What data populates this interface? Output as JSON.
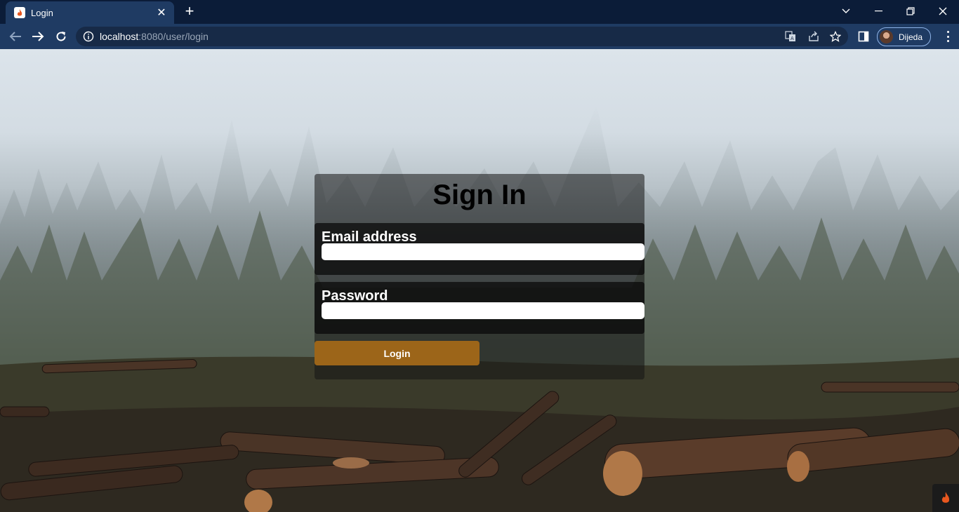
{
  "browser": {
    "tab_title": "Login",
    "url_host": "localhost",
    "url_rest": ":8080/user/login",
    "profile_name": "Dijeda",
    "accent": "#1f3b63",
    "tabstrip_color": "#0b1c38"
  },
  "icons": {
    "favicon": "flame-icon",
    "close": "close-icon",
    "new_tab": "plus-icon",
    "back": "arrow-left-icon",
    "forward": "arrow-right-icon",
    "reload": "reload-icon",
    "site_info": "info-icon",
    "translate": "translate-icon",
    "share": "share-icon",
    "bookmark": "star-icon",
    "side_panel": "side-panel-icon",
    "menu": "kebab-menu-icon",
    "tab_search": "chevron-down-icon",
    "minimize": "minimize-icon",
    "restore": "restore-icon",
    "window_close": "close-icon",
    "corner_badge": "flame-icon"
  },
  "login": {
    "title": "Sign In",
    "email_label": "Email address",
    "email_value": "",
    "password_label": "Password",
    "password_value": "",
    "button_label": "Login",
    "button_color": "#9c6519"
  }
}
